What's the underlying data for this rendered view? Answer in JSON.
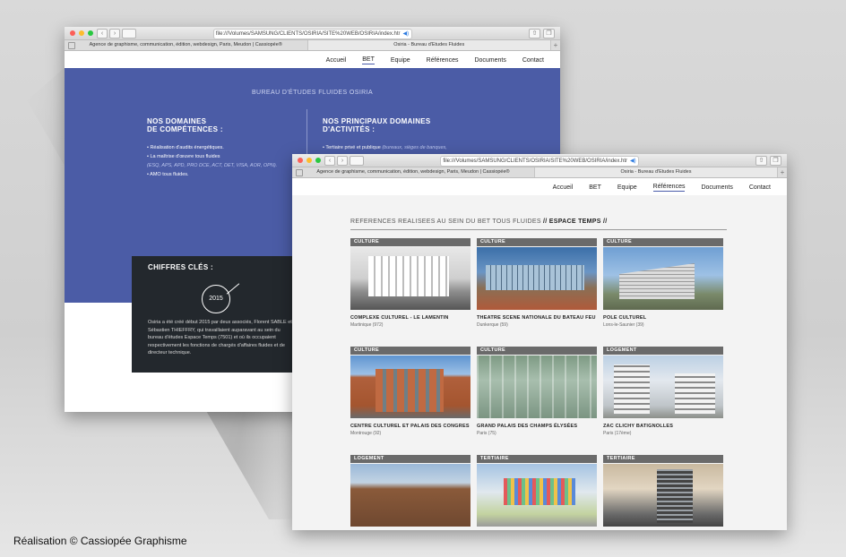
{
  "caption": "Réalisation © Cassiopée Graphisme",
  "browser": {
    "url": "file:///Volumes/SAMSUNG/CLIENTS/OSIRIA/SITE%20WEB/OSIRIA/index.htr",
    "tab1": "Agence de graphisme, communication, édition, webdesign, Paris, Meudon | Cassiopée®",
    "tab2": "Osiria - Bureau d'Etudes Fluides"
  },
  "nav": {
    "accueil": "Accueil",
    "bet": "BET",
    "equipe": "Equipe",
    "references": "Références",
    "documents": "Documents",
    "contact": "Contact"
  },
  "back_page": {
    "banner_title": "BUREAU D'ÉTUDES FLUIDES OSIRIA",
    "col1_title_1": "NOS DOMAINES",
    "col1_title_2": "DE COMPÉTENCES :",
    "col1_b1": "• Réalisation d'audits énergétiques.",
    "col1_b2": "• La maîtrise d'œuvre tous fluides",
    "col1_b2_detail": "(ESQ, APS, APD, PRO DCE, ACT, DET, VISA, AOR, OPN).",
    "col1_b3": "• AMO tous fluides.",
    "col2_title_1": "NOS PRINCIPAUX DOMAINES",
    "col2_title_2": "D'ACTIVITÉS :",
    "col2_b1": "• Tertiaire privé et publique",
    "col2_b1_detail": "(bureaux, sièges de banques,",
    "key_title": "CHIFFRES CLÉS :",
    "year": "2015",
    "key_text": "Osiria a été créé début 2015 par deux associés, Florent SABLE et Sébastien THIEFFRY, qui travaillaient auparavant au sein du bureau d'études Espace Temps (7501) et où ils occupaient respectivement les fonctions de chargés d'affaires fluides et de directeur technique."
  },
  "front_page": {
    "title_prefix": "REFERENCES REALISEES AU SEIN DU BET TOUS FLUIDES",
    "title_bold": "// ESPACE TEMPS //",
    "cards": [
      {
        "tag": "CULTURE",
        "name": "COMPLEXE CULTUREL - LE LAMENTIN",
        "loc": "Martinique (972)"
      },
      {
        "tag": "CULTURE",
        "name": "THEATRE SCENE NATIONALE DU BATEAU FEU",
        "loc": "Dunkerque (59)"
      },
      {
        "tag": "CULTURE",
        "name": "POLE CULTUREL",
        "loc": "Lons-le-Saunier (39)"
      },
      {
        "tag": "CULTURE",
        "name": "CENTRE CULTUREL ET PALAIS DES CONGRES",
        "loc": "Montrouge (92)"
      },
      {
        "tag": "CULTURE",
        "name": "GRAND PALAIS DES CHAMPS ÉLYSÉES",
        "loc": "Paris (75)"
      },
      {
        "tag": "LOGEMENT",
        "name": "ZAC CLICHY BATIGNOLLES",
        "loc": "Paris (17ème)"
      },
      {
        "tag": "LOGEMENT",
        "name": "",
        "loc": ""
      },
      {
        "tag": "TERTIAIRE",
        "name": "",
        "loc": ""
      },
      {
        "tag": "TERTIAIRE",
        "name": "",
        "loc": ""
      }
    ]
  }
}
